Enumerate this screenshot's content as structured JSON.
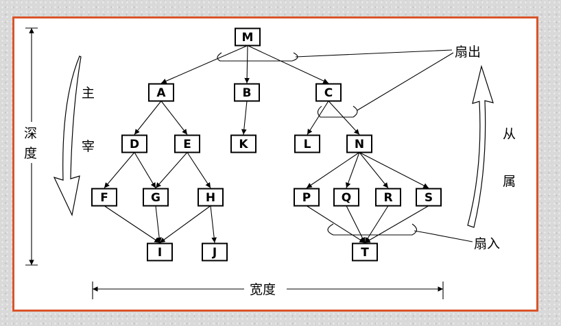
{
  "labels": {
    "fan_out": "扇出",
    "fan_in": "扇入",
    "depth": [
      "深",
      "度"
    ],
    "width": "宽度",
    "dominant": [
      "主",
      "宰"
    ],
    "subordinate": [
      "从",
      "属"
    ]
  },
  "nodes": {
    "M": "M",
    "A": "A",
    "B": "B",
    "C": "C",
    "D": "D",
    "E": "E",
    "K": "K",
    "L": "L",
    "N": "N",
    "F": "F",
    "G": "G",
    "H": "H",
    "P": "P",
    "Q": "Q",
    "R": "R",
    "S": "S",
    "I": "I",
    "J": "J",
    "T": "T"
  },
  "edges": [
    [
      "M",
      "A"
    ],
    [
      "M",
      "B"
    ],
    [
      "M",
      "C"
    ],
    [
      "A",
      "D"
    ],
    [
      "A",
      "E"
    ],
    [
      "B",
      "K"
    ],
    [
      "C",
      "L"
    ],
    [
      "C",
      "N"
    ],
    [
      "D",
      "F"
    ],
    [
      "D",
      "G"
    ],
    [
      "E",
      "G"
    ],
    [
      "E",
      "H"
    ],
    [
      "N",
      "P"
    ],
    [
      "N",
      "Q"
    ],
    [
      "N",
      "R"
    ],
    [
      "N",
      "S"
    ],
    [
      "F",
      "I"
    ],
    [
      "G",
      "I"
    ],
    [
      "H",
      "I"
    ],
    [
      "H",
      "J"
    ],
    [
      "P",
      "T"
    ],
    [
      "Q",
      "T"
    ],
    [
      "R",
      "T"
    ],
    [
      "S",
      "T"
    ]
  ]
}
